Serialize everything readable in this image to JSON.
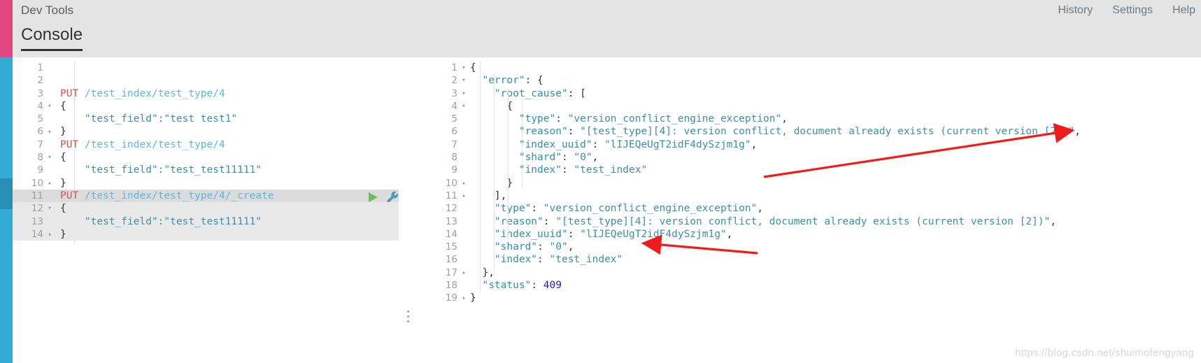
{
  "app": {
    "title": "Dev Tools",
    "watermark": "https://blog.csdn.net/shuimofengyang"
  },
  "topnav": {
    "items": [
      {
        "label": "History"
      },
      {
        "label": "Settings"
      },
      {
        "label": "Help"
      }
    ]
  },
  "tabs": [
    {
      "label": "Console",
      "active": true
    }
  ],
  "editor": {
    "icons": {
      "play": "play-icon",
      "wrench": "wrench-icon"
    },
    "active_line": 11,
    "lines": [
      {
        "n": "1",
        "fold": "",
        "text": ""
      },
      {
        "n": "2",
        "fold": "",
        "text": ""
      },
      {
        "n": "3",
        "fold": "",
        "method": "PUT",
        "url": "/test_index/test_type/4"
      },
      {
        "n": "4",
        "fold": "▾",
        "text": "{"
      },
      {
        "n": "5",
        "fold": "",
        "text": "    \"test_field\":\"test test1\"",
        "str": true
      },
      {
        "n": "6",
        "fold": "▴",
        "text": "}"
      },
      {
        "n": "7",
        "fold": "",
        "method": "PUT",
        "url": "/test_index/test_type/4"
      },
      {
        "n": "8",
        "fold": "▾",
        "text": "{"
      },
      {
        "n": "9",
        "fold": "",
        "text": "    \"test_field\":\"test_test11111\"",
        "str": true
      },
      {
        "n": "10",
        "fold": "▴",
        "text": "}"
      },
      {
        "n": "11",
        "fold": "",
        "method": "PUT",
        "url": "/test_index/test_type/4/_create",
        "highlight": true
      },
      {
        "n": "12",
        "fold": "▾",
        "text": "{",
        "highlight2": true
      },
      {
        "n": "13",
        "fold": "",
        "text": "    \"test_field\":\"test_test11111\"",
        "str": true,
        "highlight2": true
      },
      {
        "n": "14",
        "fold": "▴",
        "text": "}",
        "highlight2": true
      }
    ]
  },
  "response": {
    "lines": [
      {
        "n": "1",
        "fold": "▾",
        "indent": 0,
        "text": "{"
      },
      {
        "n": "2",
        "fold": "▾",
        "indent": 1,
        "key": "\"error\"",
        "after": ": {"
      },
      {
        "n": "3",
        "fold": "▾",
        "indent": 2,
        "key": "\"root_cause\"",
        "after": ": ["
      },
      {
        "n": "4",
        "fold": "▾",
        "indent": 3,
        "text": "{"
      },
      {
        "n": "5",
        "fold": "",
        "indent": 4,
        "key": "\"type\"",
        "sep": ": ",
        "value": "\"version_conflict_engine_exception\"",
        "tail": ","
      },
      {
        "n": "6",
        "fold": "",
        "indent": 4,
        "key": "\"reason\"",
        "sep": ": ",
        "value": "\"[test_type][4]: version conflict, document already exists (current version [2])\"",
        "tail": ","
      },
      {
        "n": "7",
        "fold": "",
        "indent": 4,
        "key": "\"index_uuid\"",
        "sep": ": ",
        "value": "\"lIJEQeUgT2idF4dySzjm1g\"",
        "tail": ","
      },
      {
        "n": "8",
        "fold": "",
        "indent": 4,
        "key": "\"shard\"",
        "sep": ": ",
        "value": "\"0\"",
        "tail": ","
      },
      {
        "n": "9",
        "fold": "",
        "indent": 4,
        "key": "\"index\"",
        "sep": ": ",
        "value": "\"test_index\"",
        "tail": ""
      },
      {
        "n": "10",
        "fold": "▴",
        "indent": 3,
        "text": "}"
      },
      {
        "n": "11",
        "fold": "▴",
        "indent": 2,
        "text": "],"
      },
      {
        "n": "12",
        "fold": "",
        "indent": 2,
        "key": "\"type\"",
        "sep": ": ",
        "value": "\"version_conflict_engine_exception\"",
        "tail": ","
      },
      {
        "n": "13",
        "fold": "",
        "indent": 2,
        "key": "\"reason\"",
        "sep": ": ",
        "value": "\"[test_type][4]: version conflict, document already exists (current version [2])\"",
        "tail": ","
      },
      {
        "n": "14",
        "fold": "",
        "indent": 2,
        "key": "\"index_uuid\"",
        "sep": ": ",
        "value": "\"lIJEQeUgT2idF4dySzjm1g\"",
        "tail": ","
      },
      {
        "n": "15",
        "fold": "",
        "indent": 2,
        "key": "\"shard\"",
        "sep": ": ",
        "value": "\"0\"",
        "tail": ","
      },
      {
        "n": "16",
        "fold": "",
        "indent": 2,
        "key": "\"index\"",
        "sep": ": ",
        "value": "\"test_index\"",
        "tail": ""
      },
      {
        "n": "17",
        "fold": "▴",
        "indent": 1,
        "text": "},"
      },
      {
        "n": "18",
        "fold": "",
        "indent": 1,
        "key": "\"status\"",
        "sep": ": ",
        "num": "409",
        "tail": ""
      },
      {
        "n": "19",
        "fold": "▴",
        "indent": 0,
        "text": "}"
      }
    ]
  },
  "annotations": [
    {
      "name": "arrow-reason-root-cause",
      "color": "#f01c1c"
    },
    {
      "name": "arrow-shard-field",
      "color": "#f01c1c"
    }
  ],
  "colors": {
    "rail_pink": "#e2457f",
    "rail_blue": "#34abd4",
    "rail_active": "#2a8fb5",
    "header_bg": "#e4e4e4",
    "method": "#d9534f",
    "url": "#5bb7e0",
    "string": "#3d8fa8",
    "number": "#2020c0",
    "annotation": "#f01c1c"
  }
}
